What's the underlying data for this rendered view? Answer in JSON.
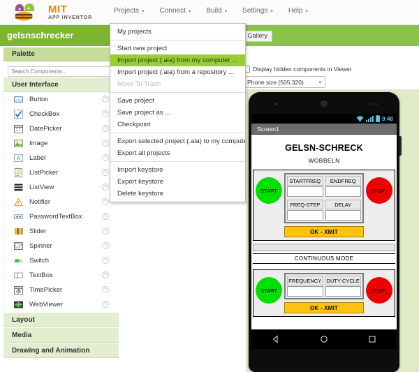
{
  "app": {
    "brand_name": "MIT",
    "brand_sub": "APP INVENTOR",
    "brand_color": "#f58220",
    "accent_green": "#8bc34a"
  },
  "menubar": {
    "items": [
      {
        "label": "Projects",
        "icon": "chevron-down-icon"
      },
      {
        "label": "Connect",
        "icon": "chevron-down-icon"
      },
      {
        "label": "Build",
        "icon": "chevron-down-icon"
      },
      {
        "label": "Settings",
        "icon": "chevron-down-icon"
      },
      {
        "label": "Help",
        "icon": "chevron-down-icon"
      }
    ]
  },
  "project": {
    "name": "gelsnschrecker",
    "gallery_button": "h to Gallery"
  },
  "projects_menu": {
    "items": [
      {
        "label": "My projects",
        "state": "normal"
      },
      {
        "label": "Start new project",
        "state": "normal"
      },
      {
        "label": "Import project (.aia) from my computer ...",
        "state": "selected"
      },
      {
        "label": "Import project (.aia) from a repository ...",
        "state": "normal"
      },
      {
        "label": "Move To Trash",
        "state": "disabled"
      },
      {
        "label": "Save project",
        "state": "normal"
      },
      {
        "label": "Save project as ...",
        "state": "normal"
      },
      {
        "label": "Checkpoint",
        "state": "normal"
      },
      {
        "label": "Export selected project (.aia) to my computer",
        "state": "normal"
      },
      {
        "label": "Export all projects",
        "state": "normal"
      },
      {
        "label": "Import keystore",
        "state": "normal"
      },
      {
        "label": "Export keystore",
        "state": "normal"
      },
      {
        "label": "Delete keystore",
        "state": "normal"
      }
    ],
    "separators_after": [
      4,
      7,
      9
    ]
  },
  "palette": {
    "title": "Palette",
    "search_placeholder": "Search Components...",
    "group_title": "User Interface",
    "components": [
      {
        "label": "Button",
        "icon": "button-icon",
        "help": "?"
      },
      {
        "label": "CheckBox",
        "icon": "checkbox-icon",
        "help": "?"
      },
      {
        "label": "DatePicker",
        "icon": "datepicker-icon",
        "help": "?"
      },
      {
        "label": "Image",
        "icon": "image-icon",
        "help": "?"
      },
      {
        "label": "Label",
        "icon": "label-icon",
        "help": "?"
      },
      {
        "label": "ListPicker",
        "icon": "listpicker-icon",
        "help": "?"
      },
      {
        "label": "ListView",
        "icon": "listview-icon",
        "help": "?"
      },
      {
        "label": "Notifier",
        "icon": "notifier-icon",
        "help": "?"
      },
      {
        "label": "PasswordTextBox",
        "icon": "passwordtextbox-icon",
        "help": "?"
      },
      {
        "label": "Slider",
        "icon": "slider-icon",
        "help": "?"
      },
      {
        "label": "Spinner",
        "icon": "spinner-icon",
        "help": "?"
      },
      {
        "label": "Switch",
        "icon": "switch-icon",
        "help": "?"
      },
      {
        "label": "TextBox",
        "icon": "textbox-icon",
        "help": "?"
      },
      {
        "label": "TimePicker",
        "icon": "timepicker-icon",
        "help": "?"
      },
      {
        "label": "WebViewer",
        "icon": "webviewer-icon",
        "help": "?"
      }
    ],
    "categories": [
      {
        "label": "Layout"
      },
      {
        "label": "Media"
      },
      {
        "label": "Drawing and Animation"
      }
    ]
  },
  "viewer": {
    "hidden_components_label": "Display hidden components in Viewer",
    "hidden_components_checked": false,
    "phone_size_value": "Phone size (505,320)",
    "dropdown_icon": "chevron-down-icon"
  },
  "phone": {
    "status": {
      "time": "9:48",
      "icons": [
        "wifi-icon",
        "signal-icon",
        "battery-icon"
      ],
      "icon_color": "#4fc3e8"
    },
    "screen_title": "Screen1",
    "app_title": "GELSN-SCHRECK",
    "app_subtitle": "WOBBELN",
    "wobbeln_panel": {
      "start_button": "START",
      "stop_button": "STOP_",
      "fields": [
        {
          "label": "STARTFREQ",
          "value": ""
        },
        {
          "label": "ENDFREQ",
          "value": ""
        },
        {
          "label": "FREQ-STEP",
          "value": ""
        },
        {
          "label": "DELAY",
          "value": ""
        }
      ],
      "submit_button": "OK - XMIT"
    },
    "mode_bar": "CONTINUOUS MODE",
    "continuous_panel": {
      "start_button": "START",
      "stop_button": "STOP_",
      "fields": [
        {
          "label": "FREQUENCY",
          "value": ""
        },
        {
          "label": "DUTY CYCLE",
          "value": ""
        }
      ],
      "submit_button": "OK - XMIT"
    },
    "navbar": {
      "back": "back-icon",
      "home": "home-icon",
      "recents": "recents-icon"
    }
  }
}
